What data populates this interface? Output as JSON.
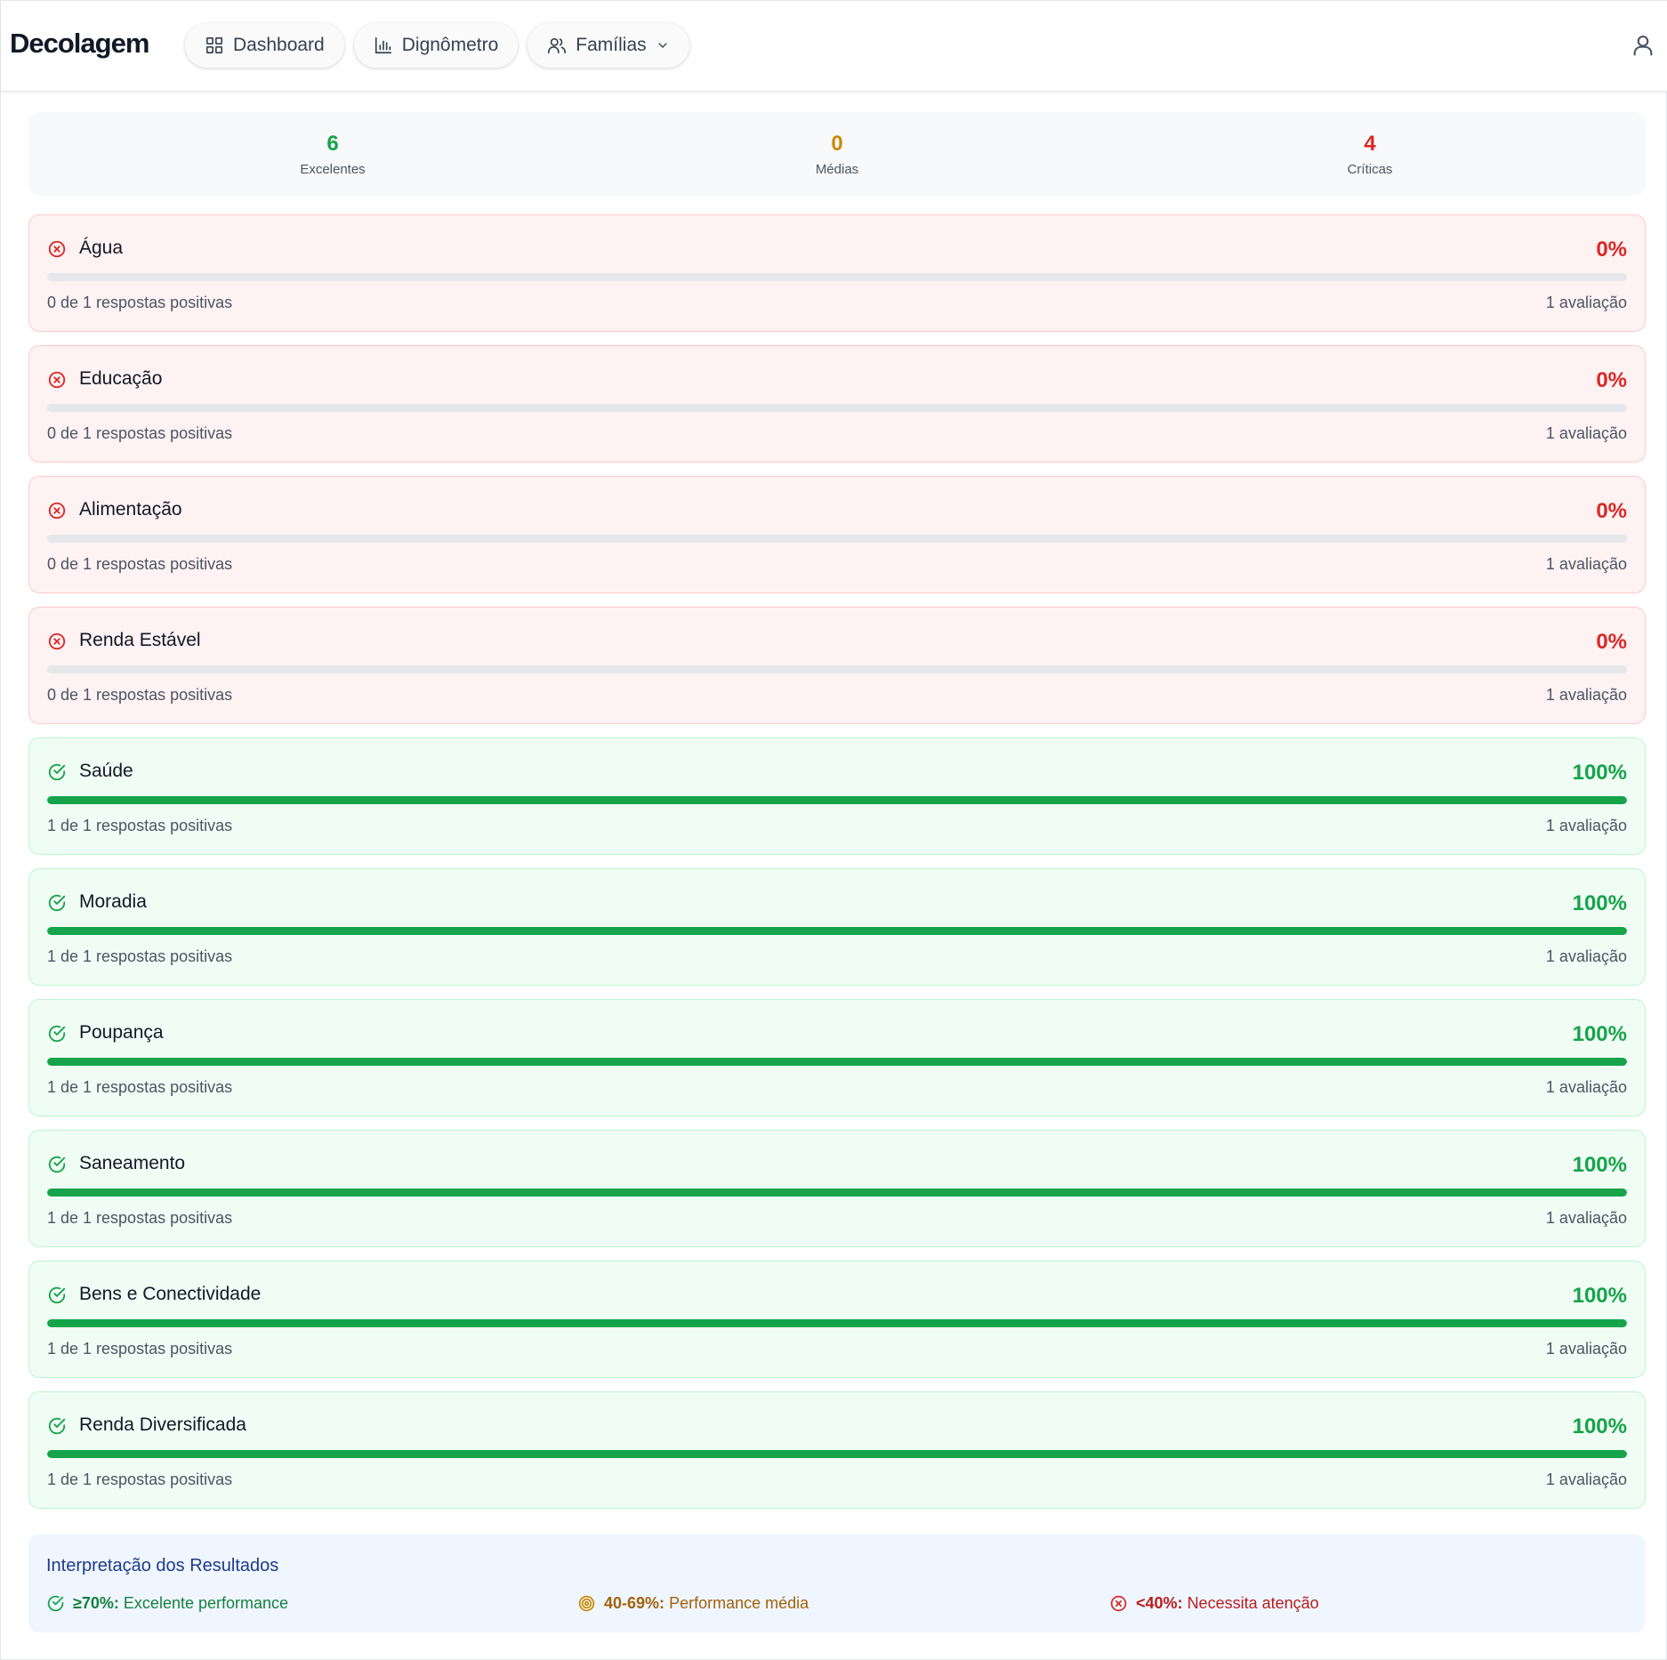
{
  "app": {
    "brand": "Decolagem"
  },
  "nav": [
    {
      "label": "Dashboard",
      "icon": "grid-icon"
    },
    {
      "label": "Dignômetro",
      "icon": "bar-chart-icon"
    },
    {
      "label": "Famílias",
      "icon": "users-icon"
    }
  ],
  "summary": {
    "excellent": {
      "value": "6",
      "label": "Excelentes",
      "color": "#16a34a"
    },
    "average": {
      "value": "0",
      "label": "Médias",
      "color": "#ca8a04"
    },
    "critical": {
      "value": "4",
      "label": "Críticas",
      "color": "#dc2626"
    }
  },
  "items": [
    {
      "name": "Água",
      "percent": "0%",
      "progress": 0,
      "status": "critical",
      "responses": "0 de 1 respostas positivas",
      "evaluations": "1 avaliação"
    },
    {
      "name": "Educação",
      "percent": "0%",
      "progress": 0,
      "status": "critical",
      "responses": "0 de 1 respostas positivas",
      "evaluations": "1 avaliação"
    },
    {
      "name": "Alimentação",
      "percent": "0%",
      "progress": 0,
      "status": "critical",
      "responses": "0 de 1 respostas positivas",
      "evaluations": "1 avaliação"
    },
    {
      "name": "Renda Estável",
      "percent": "0%",
      "progress": 0,
      "status": "critical",
      "responses": "0 de 1 respostas positivas",
      "evaluations": "1 avaliação"
    },
    {
      "name": "Saúde",
      "percent": "100%",
      "progress": 100,
      "status": "excellent",
      "responses": "1 de 1 respostas positivas",
      "evaluations": "1 avaliação"
    },
    {
      "name": "Moradia",
      "percent": "100%",
      "progress": 100,
      "status": "excellent",
      "responses": "1 de 1 respostas positivas",
      "evaluations": "1 avaliação"
    },
    {
      "name": "Poupança",
      "percent": "100%",
      "progress": 100,
      "status": "excellent",
      "responses": "1 de 1 respostas positivas",
      "evaluations": "1 avaliação"
    },
    {
      "name": "Saneamento",
      "percent": "100%",
      "progress": 100,
      "status": "excellent",
      "responses": "1 de 1 respostas positivas",
      "evaluations": "1 avaliação"
    },
    {
      "name": "Bens e Conectividade",
      "percent": "100%",
      "progress": 100,
      "status": "excellent",
      "responses": "1 de 1 respostas positivas",
      "evaluations": "1 avaliação"
    },
    {
      "name": "Renda Diversificada",
      "percent": "100%",
      "progress": 100,
      "status": "excellent",
      "responses": "1 de 1 respostas positivas",
      "evaluations": "1 avaliação"
    }
  ],
  "legend": {
    "title": "Interpretação dos Resultados",
    "excellent": {
      "range": "≥70%:",
      "text": "Excelente performance",
      "color": "#15803d",
      "icon": "check-circle-icon"
    },
    "average": {
      "range": "40-69%:",
      "text": "Performance média",
      "color": "#a16207",
      "icon": "target-icon"
    },
    "critical": {
      "range": "<40%:",
      "text": "Necessita atenção",
      "color": "#b91c1c",
      "icon": "x-circle-icon"
    }
  }
}
